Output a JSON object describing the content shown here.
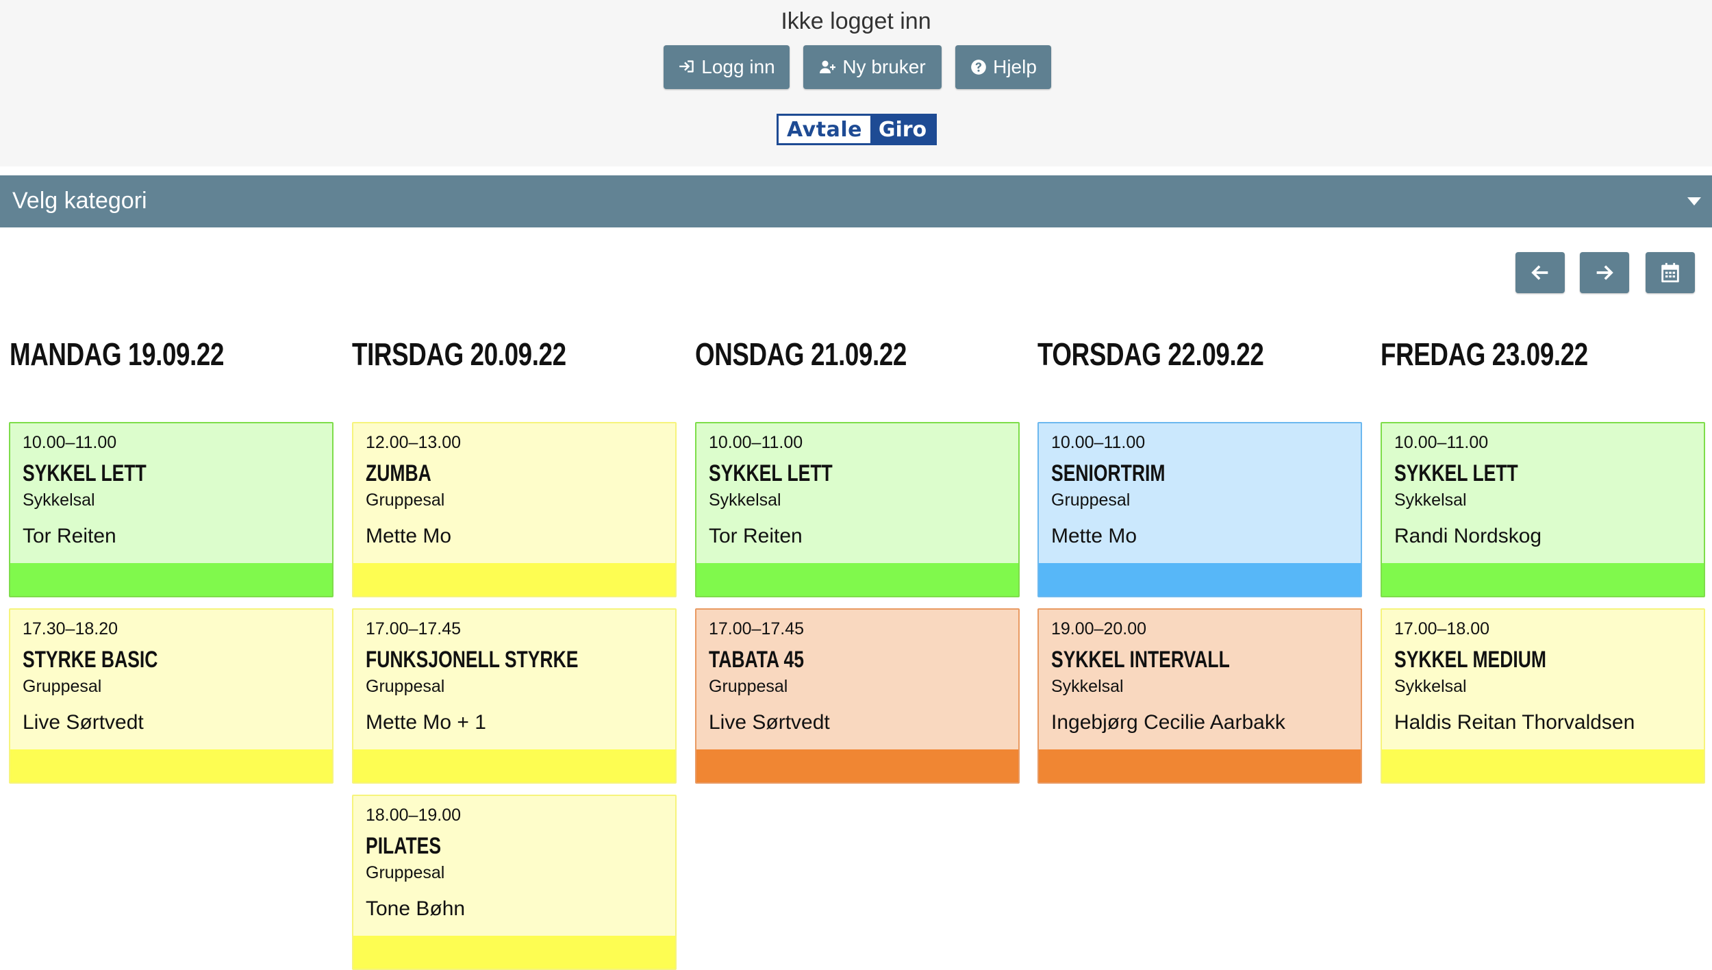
{
  "header": {
    "status": "Ikke logget inn",
    "login_label": "Logg inn",
    "new_user_label": "Ny bruker",
    "help_label": "Hjelp",
    "logo_part1": "Avtale",
    "logo_part2": "Giro"
  },
  "category": {
    "label": "Velg kategori"
  },
  "days": [
    {
      "label": "MANDAG 19.09.22",
      "classes": [
        {
          "time": "10.00–11.00",
          "title": "SYKKEL LETT",
          "room": "Sykkelsal",
          "instructor": "Tor Reiten",
          "color": "green"
        },
        {
          "time": "17.30–18.20",
          "title": "STYRKE BASIC",
          "room": "Gruppesal",
          "instructor": "Live Sørtvedt",
          "color": "yellow"
        }
      ]
    },
    {
      "label": "TIRSDAG 20.09.22",
      "classes": [
        {
          "time": "12.00–13.00",
          "title": "ZUMBA",
          "room": "Gruppesal",
          "instructor": "Mette Mo",
          "color": "yellow"
        },
        {
          "time": "17.00–17.45",
          "title": "FUNKSJONELL STYRKE",
          "room": "Gruppesal",
          "instructor": "Mette Mo + 1",
          "color": "yellow"
        },
        {
          "time": "18.00–19.00",
          "title": "PILATES",
          "room": "Gruppesal",
          "instructor": "Tone Bøhn",
          "color": "yellow"
        }
      ]
    },
    {
      "label": "ONSDAG 21.09.22",
      "classes": [
        {
          "time": "10.00–11.00",
          "title": "SYKKEL LETT",
          "room": "Sykkelsal",
          "instructor": "Tor Reiten",
          "color": "green"
        },
        {
          "time": "17.00–17.45",
          "title": "TABATA 45",
          "room": "Gruppesal",
          "instructor": "Live Sørtvedt",
          "color": "orange"
        }
      ]
    },
    {
      "label": "TORSDAG 22.09.22",
      "classes": [
        {
          "time": "10.00–11.00",
          "title": "SENIORTRIM",
          "room": "Gruppesal",
          "instructor": "Mette Mo",
          "color": "blue"
        },
        {
          "time": "19.00–20.00",
          "title": "SYKKEL INTERVALL",
          "room": "Sykkelsal",
          "instructor": "Ingebjørg Cecilie Aarbakk",
          "color": "orange"
        }
      ]
    },
    {
      "label": "FREDAG 23.09.22",
      "classes": [
        {
          "time": "10.00–11.00",
          "title": "SYKKEL LETT",
          "room": "Sykkelsal",
          "instructor": "Randi Nordskog",
          "color": "green"
        },
        {
          "time": "17.00–18.00",
          "title": "SYKKEL MEDIUM",
          "room": "Sykkelsal",
          "instructor": "Haldis Reitan Thorvaldsen",
          "color": "yellow"
        }
      ]
    }
  ],
  "colors": {
    "nav_button": "#5f8091",
    "category_bar": "#628394",
    "green": "#80f94c",
    "yellow": "#fdfd52",
    "blue": "#57b7f8",
    "orange": "#f08633"
  },
  "icons": {
    "login": "sign-in-icon",
    "new_user": "user-plus-icon",
    "help": "question-circle-icon",
    "prev": "arrow-left-icon",
    "next": "arrow-right-icon",
    "calendar": "calendar-icon",
    "category_toggle": "caret-down-icon"
  }
}
